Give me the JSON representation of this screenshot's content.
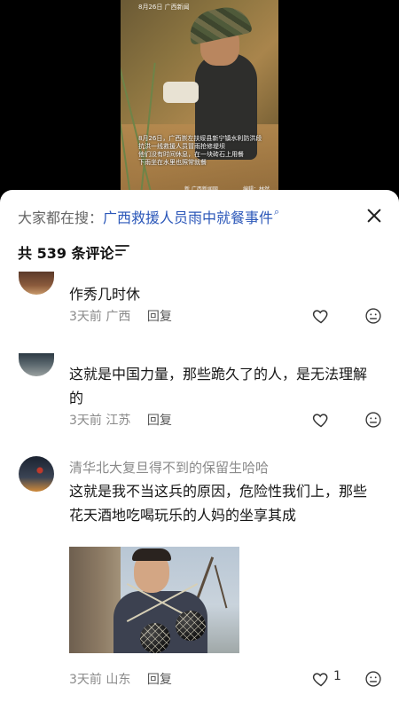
{
  "video": {
    "date_overlay": "8月26日 广西新闻",
    "caption": "8月26日，广西崇左扶绥县新宁镇水利防洪段\n抗洪一线救援人员冒雨抢修堤坝\n他们没有时间休息，在一块砖石上用餐\n下雨坐在水里也照常就餐",
    "watermark_left": "新 广西新闻网",
    "watermark_right": "编辑：林然"
  },
  "sheet": {
    "search_prefix": "大家都在搜：",
    "search_term": "广西救援人员雨中就餐事件",
    "search_icon_glyph": "⌕",
    "comment_count_label": "共 539 条评论"
  },
  "comments": [
    {
      "username": "",
      "text": "作秀几时休",
      "time": "3天前",
      "location": "广西",
      "reply": "回复",
      "likes": ""
    },
    {
      "username": "",
      "text": "这就是中国力量，那些跪久了的人，是无法理解的",
      "time": "3天前",
      "location": "江苏",
      "reply": "回复",
      "likes": ""
    },
    {
      "username": "清华北大复旦得不到的保留生哈哈",
      "text": "这就是我不当这兵的原因，危险性我们上，那些花天酒地吃喝玩乐的人妈的坐享其成",
      "time": "3天前",
      "location": "山东",
      "reply": "回复",
      "likes": "1"
    }
  ],
  "icons": {
    "close": "close-icon",
    "sort": "sort-icon",
    "like": "heart-icon",
    "dislike": "meh-face-icon"
  },
  "colors": {
    "link": "#2b57b9",
    "meta": "#8a8a8a",
    "text": "#161616"
  }
}
